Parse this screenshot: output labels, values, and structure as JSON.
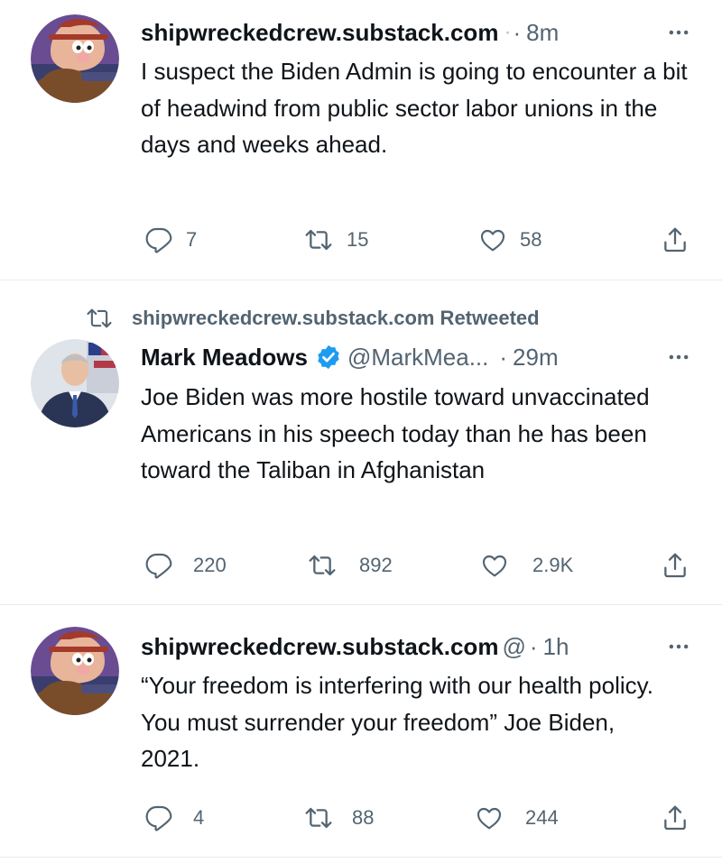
{
  "tweets": [
    {
      "author": "shipwreckedcrew.substack.com",
      "handle": "",
      "truncation": "·",
      "time": "8m",
      "text": "I suspect the Biden Admin is going to encounter a bit of headwind from public sector labor unions in the days and weeks ahead.",
      "replies": "7",
      "retweets": "15",
      "likes": "58"
    },
    {
      "retweeted_by": "shipwreckedcrew.substack.com Retweeted",
      "author": "Mark Meadows",
      "handle": "@MarkMea...",
      "time": "29m",
      "text": "Joe Biden was more hostile toward unvaccinated Americans in his speech today than he has been toward the Taliban in Afghanistan",
      "replies": "220",
      "retweets": "892",
      "likes": "2.9K"
    },
    {
      "author": "shipwreckedcrew.substack.com",
      "handle": "@",
      "time": "1h",
      "text": "“Your freedom is interfering with our health policy.  You must surrender your freedom” Joe Biden, 2021.",
      "replies": "4",
      "retweets": "88",
      "likes": "244"
    }
  ],
  "separator": "·",
  "icons": [
    "reply-icon",
    "retweet-icon",
    "like-icon",
    "share-icon",
    "more-icon",
    "verified-badge-icon"
  ],
  "colors": {
    "text": "#0f1419",
    "secondary": "#536471",
    "verified": "#1d9bf0",
    "divider": "#e6ecf0"
  }
}
